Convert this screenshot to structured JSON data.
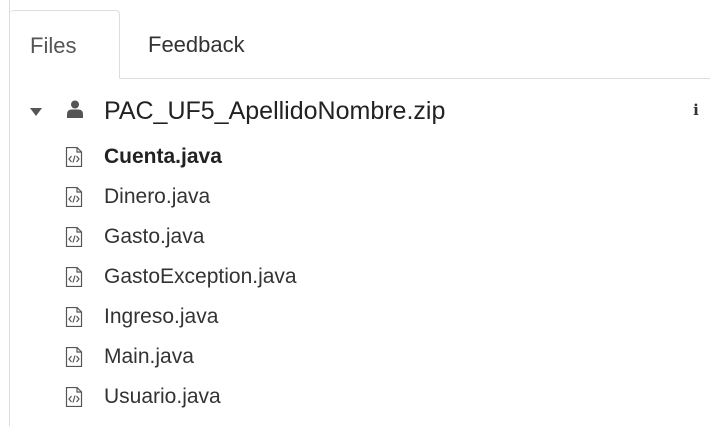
{
  "tabs": [
    {
      "label": "Files",
      "active": true
    },
    {
      "label": "Feedback",
      "active": false
    }
  ],
  "tree": {
    "root": {
      "label": "PAC_UF5_ApellidoNombre.zip",
      "expanded": true,
      "icon": "user-icon",
      "info_icon": "i"
    },
    "files": [
      {
        "label": "Cuenta.java",
        "active": true
      },
      {
        "label": "Dinero.java",
        "active": false
      },
      {
        "label": "Gasto.java",
        "active": false
      },
      {
        "label": "GastoException.java",
        "active": false
      },
      {
        "label": "Ingreso.java",
        "active": false
      },
      {
        "label": "Main.java",
        "active": false
      },
      {
        "label": "Usuario.java",
        "active": false
      }
    ]
  },
  "colors": {
    "border": "#dddddd",
    "text": "#333333",
    "icon": "#555555"
  }
}
